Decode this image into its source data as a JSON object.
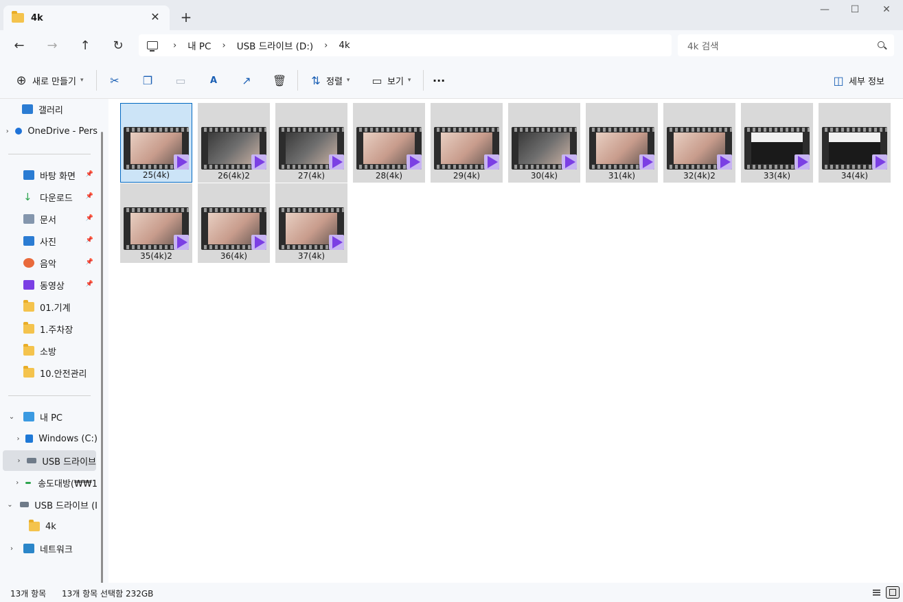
{
  "window": {
    "tab_title": "4k",
    "tab_close": "✕",
    "new_tab": "+",
    "minimize": "—",
    "maximize": "☐",
    "close": "✕"
  },
  "nav": {
    "back": "←",
    "forward": "→",
    "up": "↑",
    "refresh": "↻"
  },
  "breadcrumb": {
    "sep": "›",
    "items": [
      "내 PC",
      "USB 드라이브 (D:)",
      "4k"
    ]
  },
  "search": {
    "placeholder": "4k 검색"
  },
  "toolbar": {
    "new_label": "새로 만들기",
    "sort_label": "정렬",
    "view_label": "보기",
    "more": "···",
    "details_label": "세부 정보",
    "icons": [
      "plus-circle-icon",
      "cut-icon",
      "copy-icon",
      "paste-icon",
      "rename-icon",
      "share-icon",
      "delete-icon",
      "sort-icon",
      "view-icon",
      "more-icon",
      "details-pane-icon"
    ]
  },
  "sidebar": {
    "gallery": "갤러리",
    "onedrive": "OneDrive - Pers",
    "quick_access": [
      {
        "label": "바탕 화면",
        "icon": "desktop-icon"
      },
      {
        "label": "다운로드",
        "icon": "download-icon"
      },
      {
        "label": "문서",
        "icon": "document-icon"
      },
      {
        "label": "사진",
        "icon": "pictures-icon"
      },
      {
        "label": "음악",
        "icon": "music-icon"
      },
      {
        "label": "동영상",
        "icon": "videos-icon"
      }
    ],
    "folders": [
      "01.기계",
      "1.주차장",
      "소방",
      "10.안전관리"
    ],
    "this_pc": "내 PC",
    "drive_c": "Windows (C:)",
    "drive_usb": "USB 드라이브",
    "network_share": "송도대방(₩₩1",
    "usb_root": "USB 드라이브 (I",
    "usb_folder": "4k",
    "network": "네트워크"
  },
  "files": [
    {
      "name": "25(4k)",
      "selected": true
    },
    {
      "name": "26(4k)2",
      "selected": false
    },
    {
      "name": "27(4k)",
      "selected": false
    },
    {
      "name": "28(4k)",
      "selected": false
    },
    {
      "name": "29(4k)",
      "selected": false
    },
    {
      "name": "30(4k)",
      "selected": false
    },
    {
      "name": "31(4k)",
      "selected": false
    },
    {
      "name": "32(4k)2",
      "selected": false
    },
    {
      "name": "33(4k)",
      "selected": false
    },
    {
      "name": "34(4k)",
      "selected": false
    },
    {
      "name": "35(4k)2",
      "selected": false
    },
    {
      "name": "36(4k)",
      "selected": false
    },
    {
      "name": "37(4k)",
      "selected": false
    }
  ],
  "status": {
    "count": "13개 항목",
    "selection": "13개 항목 선택함 232GB"
  },
  "colors": {
    "accent": "#0067c0",
    "selection_bg": "#cce4f7",
    "video_badge": "#7b3fe4"
  }
}
